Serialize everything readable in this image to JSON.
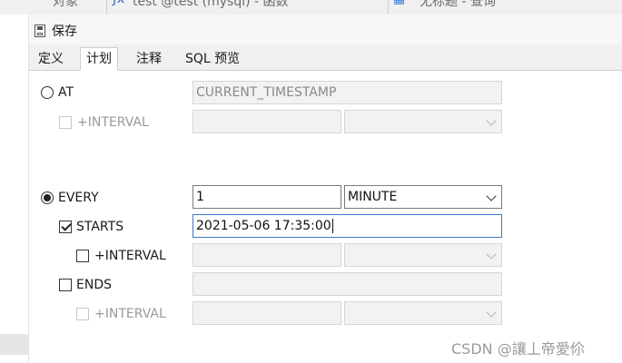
{
  "top": {
    "object_label": "对象",
    "doc_title": "test @test (mysql) - 函数",
    "query_title": "无标题 - 查询"
  },
  "toolbar": {
    "save_label": "保存"
  },
  "tabs": [
    {
      "label": "定义",
      "active": false
    },
    {
      "label": "计划",
      "active": true
    },
    {
      "label": "注释",
      "active": false
    },
    {
      "label": "SQL 预览",
      "active": false
    }
  ],
  "schedule": {
    "at": {
      "label": "AT",
      "selected": false,
      "value": "CURRENT_TIMESTAMP",
      "interval": {
        "label": "+INTERVAL",
        "checked": false,
        "value": "",
        "unit": ""
      }
    },
    "every": {
      "label": "EVERY",
      "selected": true,
      "value": "1",
      "unit": "MINUTE"
    },
    "starts": {
      "label": "STARTS",
      "checked": true,
      "value": "2021-05-06 17:35:00",
      "interval": {
        "label": "+INTERVAL",
        "checked": false,
        "value": "",
        "unit": ""
      }
    },
    "ends": {
      "label": "ENDS",
      "checked": false,
      "value": "",
      "interval": {
        "label": "+INTERVAL",
        "checked": false,
        "value": "",
        "unit": ""
      }
    }
  },
  "watermark": "CSDN @讓丄帝愛伱"
}
